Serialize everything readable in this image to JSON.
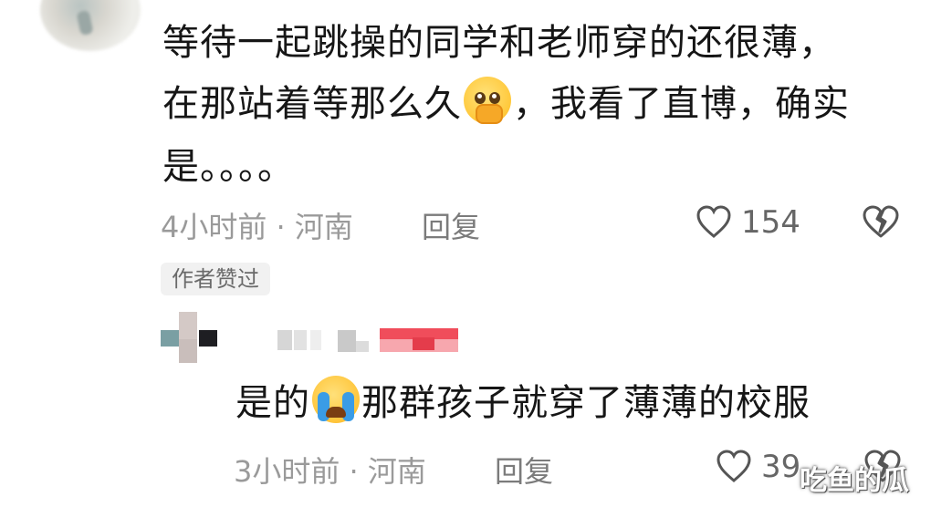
{
  "comment": {
    "text_line1": "等待一起跳操的同学和老师穿的还很薄，",
    "text_line2_a": "在那站着等那么久",
    "emoji1": "hand-over-mouth-emoji",
    "text_line2_b": "，我看了直博，确实",
    "text_line3": "是。。。。",
    "time_location": "4小时前 · 河南",
    "reply_label": "回复",
    "like_count": "154",
    "author_badge": "作者赞过"
  },
  "reply": {
    "text_a": "是的",
    "emoji": "loudly-crying-emoji",
    "text_b": "那群孩子就穿了薄薄的校服",
    "time_location": "3小时前 · 河南",
    "reply_label": "回复",
    "like_count": "39"
  },
  "watermark": "吃鱼的瓜",
  "colors": {
    "text": "#161616",
    "meta": "#9a9a9a",
    "badge_bg": "#f1f1f1"
  }
}
